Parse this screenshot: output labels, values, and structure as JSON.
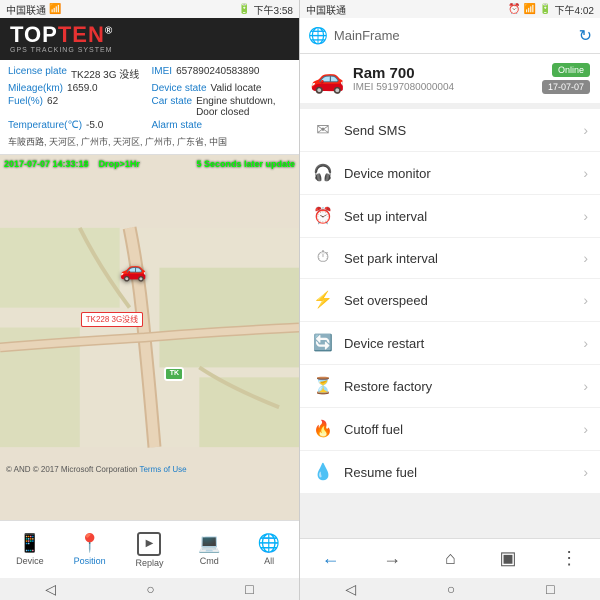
{
  "left": {
    "statusBar": {
      "carrier": "中国联通",
      "time": "下午3:58",
      "icons": "📶"
    },
    "logo": {
      "brand": "TOPTEN",
      "sub": "GPS TRACKING SYSTEM",
      "highlight": "TEN"
    },
    "infoCard": {
      "licensePlateLabel": "License plate",
      "licensePlateValue": "TK228 3G 没线",
      "imeiLabel": "IMEI",
      "imeiValue": "657890240583890",
      "mileageLabel": "Mileage(km)",
      "mileageValue": "1659.0",
      "deviceStateLabel": "Device state",
      "deviceStateValue": "Valid locate",
      "fuelLabel": "Fuel(%)",
      "fuelValue": "62",
      "carStateLabel": "Car state",
      "carStateValue": "Engine shutdown, Door closed",
      "tempLabel": "Temperature(℃)",
      "tempValue": "-5.0",
      "alarmStateLabel": "Alarm state",
      "alarmStateValue": "",
      "address": "车陂西路, 天河区, 广州市, 天河区, 广州市, 广东省, 中国"
    },
    "map": {
      "timestamp": "2017-07-07 14:33:18",
      "dropInfo": "Drop>1Hr",
      "updateInfo": "5 Seconds later update",
      "carLabel": "TK228 3G没线",
      "copyright": "© AND © 2017 Microsoft Corporation",
      "termsLink": "Terms of Use",
      "scale": "1000m"
    },
    "bottomNav": {
      "items": [
        {
          "id": "device",
          "label": "Device",
          "icon": "📱"
        },
        {
          "id": "position",
          "label": "Position",
          "icon": "📍",
          "active": true
        },
        {
          "id": "replay",
          "label": "Replay",
          "icon": "▶"
        },
        {
          "id": "cmd",
          "label": "Cmd",
          "icon": "💻"
        },
        {
          "id": "all",
          "label": "All",
          "icon": "🌐"
        }
      ]
    }
  },
  "right": {
    "statusBar": {
      "carrier": "中国联通",
      "time": "下午4:02"
    },
    "topbar": {
      "label": "MainFrame"
    },
    "vehicle": {
      "name": "Ram 700",
      "imei": "IMEI  59197080000004",
      "badgeOnline": "Online",
      "badgeDate": "17-07-07"
    },
    "menuItems": [
      {
        "id": "send-sms",
        "icon": "✉",
        "label": "Send SMS"
      },
      {
        "id": "device-monitor",
        "icon": "🎧",
        "label": "Device monitor"
      },
      {
        "id": "set-interval",
        "icon": "⏰",
        "label": "Set up interval"
      },
      {
        "id": "park-interval",
        "icon": "⏱",
        "label": "Set park interval"
      },
      {
        "id": "overspeed",
        "icon": "⚡",
        "label": "Set overspeed"
      },
      {
        "id": "restart",
        "icon": "🔄",
        "label": "Device restart"
      },
      {
        "id": "restore",
        "icon": "⏳",
        "label": "Restore factory"
      },
      {
        "id": "cutoff-fuel",
        "icon": "🔥",
        "label": "Cutoff fuel"
      },
      {
        "id": "resume-fuel",
        "icon": "💧",
        "label": "Resume fuel"
      }
    ]
  }
}
